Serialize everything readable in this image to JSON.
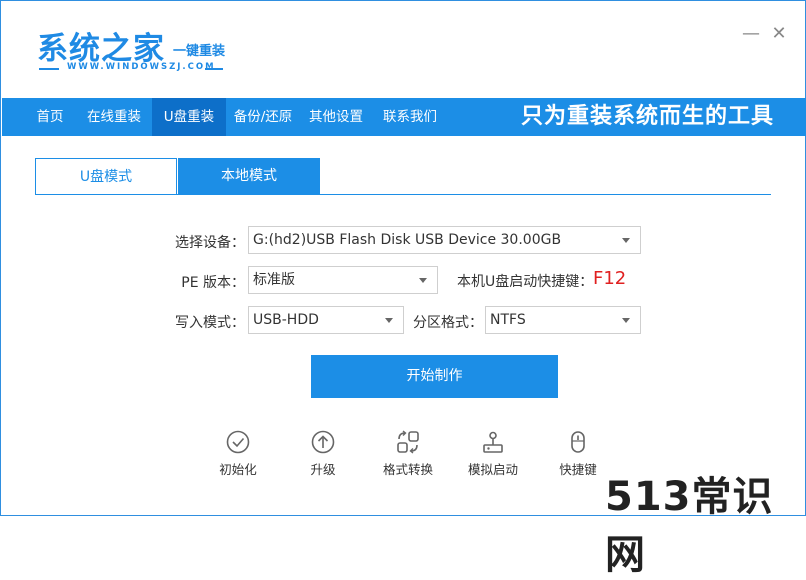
{
  "header": {
    "logo_title": "系统之家",
    "logo_subtitle": "一键重装",
    "logo_url": "WWW.WINDOWSZJ.COM",
    "minimize": "—",
    "close": "✕"
  },
  "nav": {
    "items": [
      "首页",
      "在线重装",
      "U盘重装",
      "备份/还原",
      "其他设置",
      "联系我们"
    ],
    "active": "U盘重装",
    "slogan": "只为重装系统而生的工具"
  },
  "tabs": {
    "items": [
      "U盘模式",
      "本地模式"
    ],
    "active": "U盘模式"
  },
  "form": {
    "device_label": "选择设备：",
    "device_value": "G:(hd2)USB Flash Disk USB Device 30.00GB",
    "pe_label": "PE 版本：",
    "pe_value": "标准版",
    "hotkey_label": "本机U盘启动快捷键：",
    "hotkey_value": "F12",
    "write_label": "写入模式：",
    "write_value": "USB-HDD",
    "partition_label": "分区格式：",
    "partition_value": "NTFS"
  },
  "start_button": "开始制作",
  "tools": [
    {
      "label": "初始化",
      "icon": "check-circle-icon"
    },
    {
      "label": "升级",
      "icon": "arrow-up-circle-icon"
    },
    {
      "label": "格式转换",
      "icon": "convert-icon"
    },
    {
      "label": "模拟启动",
      "icon": "joystick-icon"
    },
    {
      "label": "快捷键",
      "icon": "mouse-icon"
    }
  ],
  "watermark": "513常识网",
  "colors": {
    "accent": "#1c8ee6",
    "accent_dark": "#0d6fc9",
    "hotkey": "#e02020"
  }
}
